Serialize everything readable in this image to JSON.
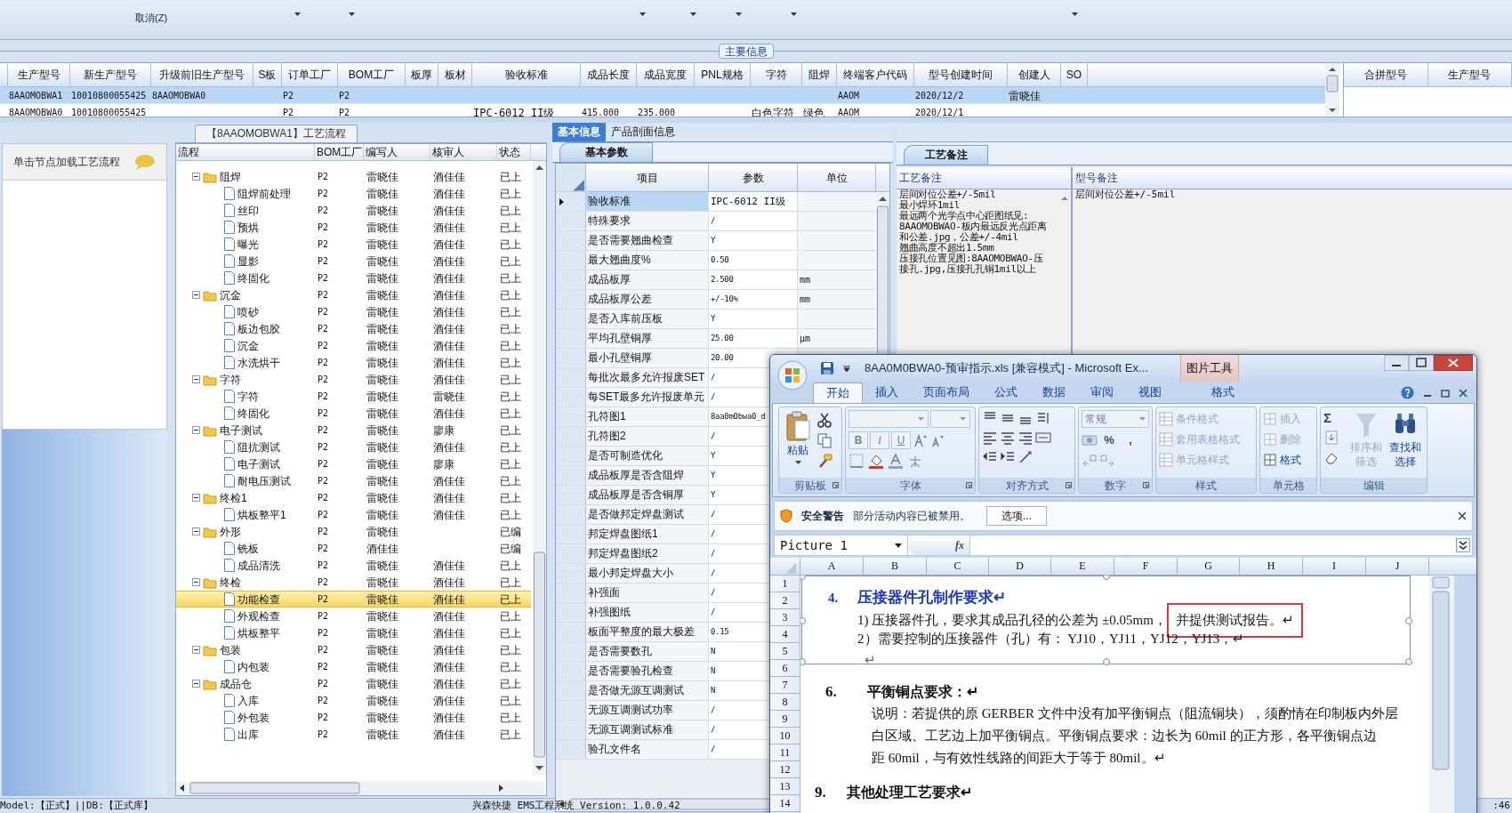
{
  "toolbar": {
    "items": [
      "取消(Z)"
    ]
  },
  "main_info": {
    "title": "主要信息",
    "columns": [
      "生产型号",
      "新生产型号",
      "升级前旧生产型号",
      "S板",
      "订单工厂",
      "BOM工厂",
      "板厚",
      "板材",
      "验收标准",
      "成品长度",
      "成品宽度",
      "PNL规格",
      "字符",
      "阻焊",
      "终端客户代码",
      "型号创建时间",
      "创建人",
      "SO"
    ],
    "rows": [
      {
        "selected": true,
        "cells": [
          "8AAOMOBWA1",
          "10010800055425",
          "8AAOMOBWA0",
          "",
          "P2",
          "P2",
          "",
          "",
          "",
          "",
          "",
          "",
          "",
          "",
          "AAOM",
          "2020/12/2",
          "雷晓佳",
          ""
        ]
      },
      {
        "selected": false,
        "cells": [
          "8AAOMOBWA0",
          "10010800055425",
          "",
          "",
          "P2",
          "P2",
          "",
          "",
          "IPC-6012 II级",
          "415.000",
          "235.000",
          "",
          "白色字符",
          "绿色",
          "AAOM",
          "2020/12/1",
          "",
          ""
        ]
      }
    ]
  },
  "merge_panel": {
    "columns": [
      "合拼型号",
      "生产型号"
    ]
  },
  "process_panel": {
    "tab": "【8AAOMOBWA1】工艺流程",
    "hint": "单击节点加载工艺流程",
    "columns": [
      "流程",
      "BOM工厂",
      "编写人",
      "核审人",
      "状态"
    ],
    "tree": [
      {
        "name": "阻焊",
        "cells": [
          "P2",
          "雷晓佳",
          "酒佳佳",
          "已上"
        ],
        "expanded": true,
        "selected": false,
        "children": [
          {
            "name": "阻焊前处理",
            "cells": [
              "P2",
              "雷晓佳",
              "酒佳佳",
              "已上"
            ],
            "selected": false
          },
          {
            "name": "丝印",
            "cells": [
              "P2",
              "雷晓佳",
              "酒佳佳",
              "已上"
            ],
            "selected": false
          },
          {
            "name": "预烘",
            "cells": [
              "P2",
              "雷晓佳",
              "酒佳佳",
              "已上"
            ],
            "selected": false
          },
          {
            "name": "曝光",
            "cells": [
              "P2",
              "雷晓佳",
              "酒佳佳",
              "已上"
            ],
            "selected": false
          },
          {
            "name": "显影",
            "cells": [
              "P2",
              "雷晓佳",
              "酒佳佳",
              "已上"
            ],
            "selected": false
          },
          {
            "name": "终固化",
            "cells": [
              "P2",
              "雷晓佳",
              "酒佳佳",
              "已上"
            ],
            "selected": false
          }
        ]
      },
      {
        "name": "沉金",
        "cells": [
          "P2",
          "雷晓佳",
          "酒佳佳",
          "已上"
        ],
        "expanded": true,
        "selected": false,
        "children": [
          {
            "name": "喷砂",
            "cells": [
              "P2",
              "雷晓佳",
              "酒佳佳",
              "已上"
            ],
            "selected": false
          },
          {
            "name": "板边包胶",
            "cells": [
              "P2",
              "雷晓佳",
              "酒佳佳",
              "已上"
            ],
            "selected": false
          },
          {
            "name": "沉金",
            "cells": [
              "P2",
              "雷晓佳",
              "酒佳佳",
              "已上"
            ],
            "selected": false
          },
          {
            "name": "水洗烘干",
            "cells": [
              "P2",
              "雷晓佳",
              "酒佳佳",
              "已上"
            ],
            "selected": false
          }
        ]
      },
      {
        "name": "字符",
        "cells": [
          "P2",
          "雷晓佳",
          "酒佳佳",
          "已上"
        ],
        "expanded": true,
        "selected": false,
        "children": [
          {
            "name": "字符",
            "cells": [
              "P2",
              "雷晓佳",
              "雷晓佳",
              "已上"
            ],
            "selected": false
          },
          {
            "name": "终固化",
            "cells": [
              "P2",
              "雷晓佳",
              "酒佳佳",
              "已上"
            ],
            "selected": false
          }
        ]
      },
      {
        "name": "电子测试",
        "cells": [
          "P2",
          "雷晓佳",
          "廖康",
          "已上"
        ],
        "expanded": true,
        "selected": false,
        "children": [
          {
            "name": "阻抗测试",
            "cells": [
              "P2",
              "雷晓佳",
              "酒佳佳",
              "已上"
            ],
            "selected": false
          },
          {
            "name": "电子测试",
            "cells": [
              "P2",
              "雷晓佳",
              "廖康",
              "已上"
            ],
            "selected": false
          },
          {
            "name": "耐电压测试",
            "cells": [
              "P2",
              "雷晓佳",
              "酒佳佳",
              "已上"
            ],
            "selected": false
          }
        ]
      },
      {
        "name": "终检1",
        "cells": [
          "P2",
          "雷晓佳",
          "酒佳佳",
          "已上"
        ],
        "expanded": true,
        "selected": false,
        "children": [
          {
            "name": "烘板整平1",
            "cells": [
              "P2",
              "雷晓佳",
              "酒佳佳",
              "已上"
            ],
            "selected": false
          }
        ]
      },
      {
        "name": "外形",
        "cells": [
          "P2",
          "雷晓佳",
          "",
          "已编"
        ],
        "expanded": true,
        "selected": false,
        "children": [
          {
            "name": "铣板",
            "cells": [
              "P2",
              "酒佳佳",
              "",
              "已编"
            ],
            "selected": false
          },
          {
            "name": "成品清洗",
            "cells": [
              "P2",
              "雷晓佳",
              "酒佳佳",
              "已上"
            ],
            "selected": false
          }
        ]
      },
      {
        "name": "终检",
        "cells": [
          "P2",
          "雷晓佳",
          "酒佳佳",
          "已上"
        ],
        "expanded": true,
        "selected": false,
        "children": [
          {
            "name": "功能检查",
            "cells": [
              "P2",
              "雷晓佳",
              "酒佳佳",
              "已上"
            ],
            "selected": true
          },
          {
            "name": "外观检查",
            "cells": [
              "P2",
              "雷晓佳",
              "酒佳佳",
              "已上"
            ],
            "selected": false
          },
          {
            "name": "烘板整平",
            "cells": [
              "P2",
              "雷晓佳",
              "酒佳佳",
              "已上"
            ],
            "selected": false
          }
        ]
      },
      {
        "name": "包装",
        "cells": [
          "P2",
          "雷晓佳",
          "酒佳佳",
          "已上"
        ],
        "expanded": true,
        "selected": false,
        "children": [
          {
            "name": "内包装",
            "cells": [
              "P2",
              "雷晓佳",
              "酒佳佳",
              "已上"
            ],
            "selected": false
          }
        ]
      },
      {
        "name": "成品仓",
        "cells": [
          "P2",
          "雷晓佳",
          "酒佳佳",
          "已上"
        ],
        "expanded": true,
        "selected": false,
        "children": [
          {
            "name": "入库",
            "cells": [
              "P2",
              "雷晓佳",
              "酒佳佳",
              "已上"
            ],
            "selected": false
          },
          {
            "name": "外包装",
            "cells": [
              "P2",
              "雷晓佳",
              "酒佳佳",
              "已上"
            ],
            "selected": false
          },
          {
            "name": "出库",
            "cells": [
              "P2",
              "雷晓佳",
              "酒佳佳",
              "已上"
            ],
            "selected": false
          }
        ]
      }
    ]
  },
  "detail": {
    "tabs": [
      {
        "label": "基本信息",
        "selected": true
      },
      {
        "label": "产品剖面信息",
        "selected": false
      }
    ],
    "subtab": "基本参数",
    "columns": [
      "项目",
      "参数",
      "单位"
    ],
    "rows": [
      {
        "item": "验收标准",
        "value": "IPC-6012 II级",
        "unit": "",
        "selected": true
      },
      {
        "item": "特殊要求",
        "value": "/",
        "unit": "",
        "selected": false
      },
      {
        "item": "是否需要翘曲检查",
        "value": "Y",
        "unit": "",
        "selected": false
      },
      {
        "item": "最大翘曲度%",
        "value": "0.50",
        "unit": "",
        "selected": false
      },
      {
        "item": "成品板厚",
        "value": "2.500",
        "unit": "mm",
        "selected": false
      },
      {
        "item": "成品板厚公差",
        "value": "+/-10%",
        "unit": "mm",
        "selected": false
      },
      {
        "item": "是否入库前压板",
        "value": "Y",
        "unit": "",
        "selected": false
      },
      {
        "item": "平均孔壁铜厚",
        "value": "25.00",
        "unit": "μm",
        "selected": false
      },
      {
        "item": "最小孔壁铜厚",
        "value": "20.00",
        "unit": "",
        "selected": false
      },
      {
        "item": "每批次最多允许报废SET",
        "value": "/",
        "unit": "",
        "selected": false
      },
      {
        "item": "每SET最多允许报废单元",
        "value": "/",
        "unit": "",
        "selected": false
      },
      {
        "item": "孔符图1",
        "value": "8aa0m0bwa0_d",
        "unit": "",
        "selected": false
      },
      {
        "item": "孔符图2",
        "value": "/",
        "unit": "",
        "selected": false
      },
      {
        "item": "是否可制造优化",
        "value": "Y",
        "unit": "",
        "selected": false
      },
      {
        "item": "成品板厚是否含阻焊",
        "value": "Y",
        "unit": "",
        "selected": false
      },
      {
        "item": "成品板厚是否含铜厚",
        "value": "Y",
        "unit": "",
        "selected": false
      },
      {
        "item": "是否做邦定焊盘测试",
        "value": "/",
        "unit": "",
        "selected": false
      },
      {
        "item": "邦定焊盘图纸1",
        "value": "/",
        "unit": "",
        "selected": false
      },
      {
        "item": "邦定焊盘图纸2",
        "value": "/",
        "unit": "",
        "selected": false
      },
      {
        "item": "最小邦定焊盘大小",
        "value": "/",
        "unit": "",
        "selected": false
      },
      {
        "item": "补强面",
        "value": "/",
        "unit": "",
        "selected": false
      },
      {
        "item": "补强图纸",
        "value": "/",
        "unit": "",
        "selected": false
      },
      {
        "item": "板面平整度的最大极差",
        "value": "0.15",
        "unit": "",
        "selected": false
      },
      {
        "item": "是否需要数孔",
        "value": "N",
        "unit": "",
        "selected": false
      },
      {
        "item": "是否需要验孔检查",
        "value": "N",
        "unit": "",
        "selected": false
      },
      {
        "item": "是否做无源互调测试",
        "value": "N",
        "unit": "",
        "selected": false
      },
      {
        "item": "无源互调测试功率",
        "value": "/",
        "unit": "",
        "selected": false
      },
      {
        "item": "无源互调测试标准",
        "value": "/",
        "unit": "",
        "selected": false
      },
      {
        "item": "验孔文件名",
        "value": "/",
        "unit": "",
        "selected": false
      }
    ]
  },
  "notes": {
    "tab": "工艺备注",
    "columns": [
      "工艺备注",
      "型号备注"
    ],
    "process_note": [
      "层间对位公差+/-5mil",
      "最小焊环1mil",
      "最远两个光学点中心距图纸见:",
      "8AAOMOBWAO-板内最远反光点距离",
      "和公差.jpg，公差+/-4mil",
      "翘曲高度不超出1.5mm",
      "压接孔位置见图:8AAOMOBWAO-压",
      "接孔.jpg,压接孔孔铜1mil以上"
    ],
    "model_note": "层间对位公差+/-5mil"
  },
  "excel": {
    "title": "8AA0M0BWA0-预审指示.xls  [兼容模式] - Microsoft Ex...",
    "context_tab": "图片工具",
    "tabs": [
      {
        "label": "开始",
        "selected": true
      },
      {
        "label": "插入",
        "selected": false
      },
      {
        "label": "页面布局",
        "selected": false
      },
      {
        "label": "公式",
        "selected": false
      },
      {
        "label": "数据",
        "selected": false
      },
      {
        "label": "审阅",
        "selected": false
      },
      {
        "label": "视图",
        "selected": false
      },
      {
        "label": "格式",
        "selected": false
      }
    ],
    "ribbon": {
      "groups": [
        "剪贴板",
        "字体",
        "对齐方式",
        "数字",
        "样式",
        "单元格",
        "编辑"
      ],
      "paste": "粘贴",
      "font_buttons": [
        "B",
        "I",
        "U"
      ],
      "number_format": "常规",
      "number_buttons": [
        "%",
        ","
      ],
      "style_buttons": [
        {
          "label": "条件格式",
          "disabled": true
        },
        {
          "label": "套用表格格式",
          "disabled": true
        },
        {
          "label": "单元格样式",
          "disabled": true
        }
      ],
      "cell_buttons": [
        {
          "label": "插入",
          "disabled": true
        },
        {
          "label": "删除",
          "disabled": true
        },
        {
          "label": "格式",
          "disabled": false
        }
      ],
      "sum": "Σ",
      "edit_buttons": [
        {
          "label": "排序和筛选",
          "disabled": true
        },
        {
          "label": "查找和选择",
          "disabled": false
        }
      ]
    },
    "security": {
      "title": "安全警告",
      "message": "部分活动内容已被禁用。",
      "button": "选项..."
    },
    "name_box": "Picture 1",
    "formula_label": "fx",
    "columns": [
      "A",
      "B",
      "C",
      "D",
      "E",
      "F",
      "G",
      "H",
      "I",
      "J"
    ],
    "rows": [
      "1",
      "2",
      "3",
      "4",
      "5",
      "6",
      "7",
      "8",
      "9",
      "10",
      "11",
      "12",
      "13",
      "14"
    ],
    "content": {
      "heading4": {
        "number": "4.",
        "title": "压接器件孔制作要求↵"
      },
      "line1": {
        "text": "1) 压接器件孔，要求其成品孔径的公差为 ±0.05mm，",
        "highlight": "并提供测试报告。↵"
      },
      "line2": "2）需要控制的压接器件（孔）有： YJ10，YJ11，YJ12，YJ13，↵",
      "return_mark": "↵",
      "heading6": {
        "number": "6.",
        "title": "平衡铜点要求：↵"
      },
      "paragraph": [
        "说明：若提供的原 GERBER 文件中没有加平衡铜点（阻流铜块），须酌情在印制板内外层",
        "白区域、工艺边上加平衡铜点。平衡铜点要求：边长为 60mil 的正方形，各平衡铜点边",
        "距 60mil，与有效性线路的间距大于等于 80mil。↵"
      ],
      "heading9": {
        "number": "9.",
        "title": "其他处理工艺要求↵"
      }
    }
  },
  "status_bar": {
    "left": "Model:【正式】||DB:【正式库】",
    "center": "兴森快捷  EMS工程系统  Version: 1.0.0.42",
    "clock": ":46"
  }
}
